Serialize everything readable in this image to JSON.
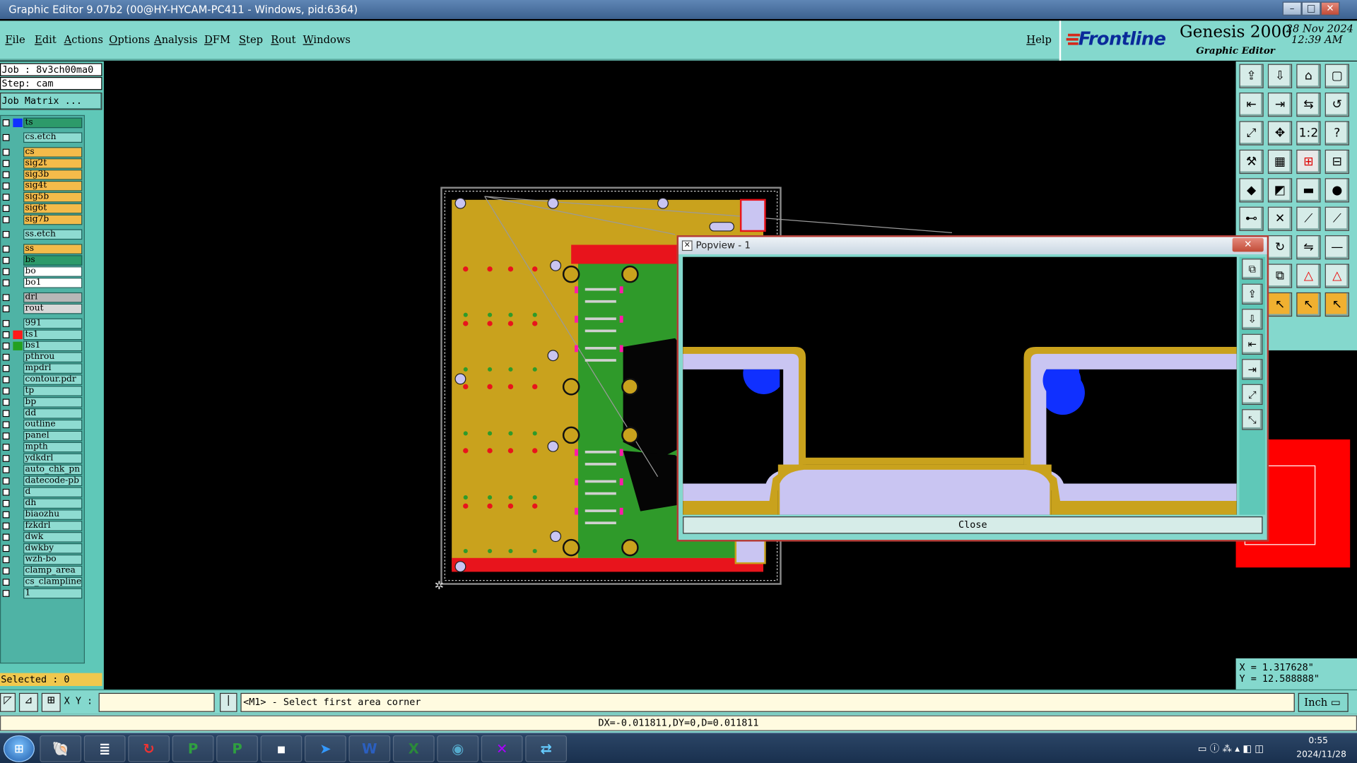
{
  "window": {
    "title": "Graphic Editor 9.07b2 (00@HY-HYCAM-PC411 - Windows, pid:6364)"
  },
  "menu": [
    "File",
    "Edit",
    "Actions",
    "Options",
    "Analysis",
    "DFM",
    "Step",
    "Rout",
    "Windows"
  ],
  "help_label": "Help",
  "brand": {
    "logo_text": "Frontline",
    "product": "Genesis 2000",
    "subtitle": "Graphic Editor",
    "date": "28 Nov 2024",
    "time": "12:39 AM"
  },
  "job": {
    "job_line": "Job : 8v3ch00ma0",
    "step_line": "Step: cam",
    "matrix_button": "Job Matrix ..."
  },
  "layers": [
    {
      "name": "ts",
      "color": "#2d9a6a",
      "swatch": "#1030ff"
    },
    {
      "name": "cs.etch",
      "color": "#8edbd1",
      "swatch": ""
    },
    {
      "name": "cs",
      "color": "#f4bb4a",
      "swatch": ""
    },
    {
      "name": "sig2t",
      "color": "#f4bb4a",
      "swatch": ""
    },
    {
      "name": "sig3b",
      "color": "#f4bb4a",
      "swatch": ""
    },
    {
      "name": "sig4t",
      "color": "#f4bb4a",
      "swatch": ""
    },
    {
      "name": "sig5b",
      "color": "#f4bb4a",
      "swatch": ""
    },
    {
      "name": "sig6t",
      "color": "#f4bb4a",
      "swatch": ""
    },
    {
      "name": "sig7b",
      "color": "#f4bb4a",
      "swatch": ""
    },
    {
      "name": "ss.etch",
      "color": "#8edbd1",
      "swatch": ""
    },
    {
      "name": "ss",
      "color": "#f4bb4a",
      "swatch": ""
    },
    {
      "name": "bs",
      "color": "#2d9a6a",
      "swatch": ""
    },
    {
      "name": "bo",
      "color": "#ffffff",
      "swatch": ""
    },
    {
      "name": "bo1",
      "color": "#ffffff",
      "swatch": ""
    },
    {
      "name": "drl",
      "color": "#b7b7b7",
      "swatch": ""
    },
    {
      "name": "rout",
      "color": "#d8d8d8",
      "swatch": ""
    },
    {
      "name": "991",
      "color": "#8edbd1",
      "swatch": ""
    },
    {
      "name": "ts1",
      "color": "#8edbd1",
      "swatch": "#ff1a1a"
    },
    {
      "name": "bs1",
      "color": "#8edbd1",
      "swatch": "#23a020"
    },
    {
      "name": "pthrou",
      "color": "#8edbd1",
      "swatch": ""
    },
    {
      "name": "mpdrl",
      "color": "#8edbd1",
      "swatch": ""
    },
    {
      "name": "contour.pdr",
      "color": "#8edbd1",
      "swatch": ""
    },
    {
      "name": "tp",
      "color": "#8edbd1",
      "swatch": ""
    },
    {
      "name": "bp",
      "color": "#8edbd1",
      "swatch": ""
    },
    {
      "name": "dd",
      "color": "#8edbd1",
      "swatch": ""
    },
    {
      "name": "outline",
      "color": "#8edbd1",
      "swatch": ""
    },
    {
      "name": "panel",
      "color": "#8edbd1",
      "swatch": ""
    },
    {
      "name": "mpth",
      "color": "#8edbd1",
      "swatch": ""
    },
    {
      "name": "ydkdrl",
      "color": "#8edbd1",
      "swatch": ""
    },
    {
      "name": "auto_chk_pn",
      "color": "#8edbd1",
      "swatch": ""
    },
    {
      "name": "datecode-pb",
      "color": "#8edbd1",
      "swatch": ""
    },
    {
      "name": "d",
      "color": "#8edbd1",
      "swatch": ""
    },
    {
      "name": "dh",
      "color": "#8edbd1",
      "swatch": ""
    },
    {
      "name": "biaozhu",
      "color": "#8edbd1",
      "swatch": ""
    },
    {
      "name": "fzkdrl",
      "color": "#8edbd1",
      "swatch": ""
    },
    {
      "name": "dwk",
      "color": "#8edbd1",
      "swatch": ""
    },
    {
      "name": "dwkby",
      "color": "#8edbd1",
      "swatch": ""
    },
    {
      "name": "wzh-bo",
      "color": "#8edbd1",
      "swatch": ""
    },
    {
      "name": "clamp_area",
      "color": "#8edbd1",
      "swatch": ""
    },
    {
      "name": "cs_clampline",
      "color": "#8edbd1",
      "swatch": ""
    },
    {
      "name": "1",
      "color": "#8edbd1",
      "swatch": ""
    }
  ],
  "selected": "Selected : 0",
  "coords": {
    "x": "X = 1.317628\"",
    "y": "Y = 12.588888\""
  },
  "units": "Inch",
  "command": {
    "xy_label": "X Y :",
    "xy_value": "",
    "prompt": "<M1> - Select first area corner"
  },
  "status": "DX=-0.011811,DY=0,D=0.011811",
  "popview": {
    "title": "Popview - 1",
    "close_label": "Close"
  },
  "clock": {
    "time": "0:55",
    "date": "2024/11/28"
  },
  "colors": {
    "menu_bg": "#84d8cd",
    "board_gold": "#c9a21d",
    "board_green": "#2f9a2a",
    "board_red": "#e8141c",
    "pad_lavender": "#c9c5f2",
    "highlight_blue": "#1030ff"
  },
  "toolbox_icons": [
    "snap-icon",
    "save-icon",
    "home-icon",
    "frame-icon",
    "back-icon",
    "forward-icon",
    "pan-icon",
    "wrap-icon",
    "fit-icon",
    "center-icon",
    "one-to-one-icon",
    "help-icon",
    "hammer-icon",
    "grid-icon",
    "measure-red-icon",
    "measure-icon",
    "fill-icon",
    "draw-icon",
    "line-icon",
    "circle-icon",
    "connect-icon",
    "cross-icon",
    "diag-icon",
    "line-diag-icon",
    "route-icon",
    "rotate-icon",
    "mirror-icon",
    "stroke-icon",
    "arrow-icon",
    "compare-icon",
    "triangle-a-icon",
    "triangle-b-icon",
    "triangle-c-icon",
    "pointer-a-icon",
    "pointer-b-icon",
    "pointer-c-icon"
  ],
  "popview_icons": [
    "zoom-icon",
    "upload-icon",
    "download-icon",
    "pan-left-icon",
    "pan-right-icon",
    "fit-screen-icon",
    "fit-all-icon"
  ],
  "taskbar_icons": [
    "start-icon",
    "shell-icon",
    "notepad-icon",
    "app-red-icon",
    "app-p-icon",
    "app-p2-icon",
    "floppy-icon",
    "arrow-app-icon",
    "word-icon",
    "excel-icon",
    "eye-app-icon",
    "x-app-icon",
    "network-app-icon"
  ]
}
